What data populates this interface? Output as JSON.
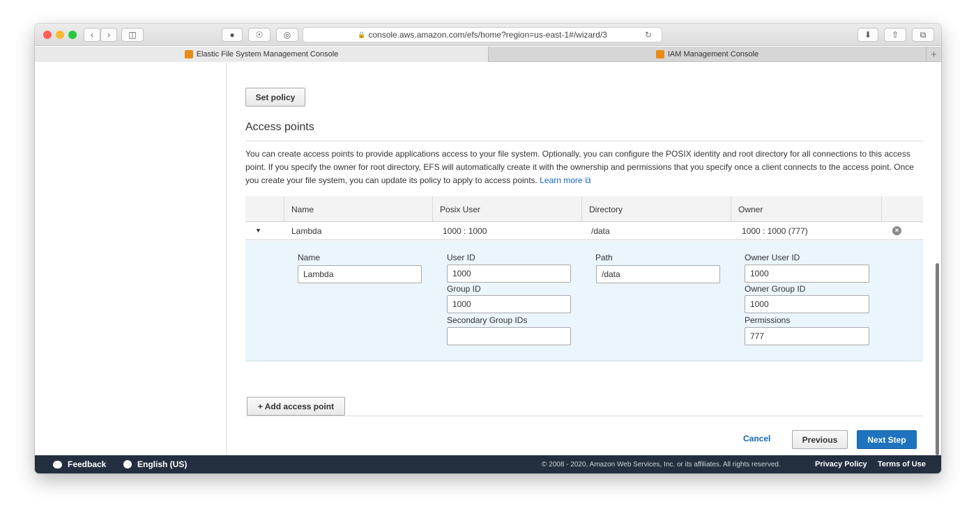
{
  "browser": {
    "url": "console.aws.amazon.com/efs/home?region=us-east-1#/wizard/3",
    "tabs": [
      {
        "label": "Elastic File System Management Console",
        "active": true
      },
      {
        "label": "IAM Management Console",
        "active": false
      }
    ],
    "new_tab_label": "+"
  },
  "set_policy_label": "Set policy",
  "access_points": {
    "heading": "Access points",
    "description": "You can create access points to provide applications access to your file system. Optionally, you can configure the POSIX identity and root directory for all connections to this access point. If you specify the owner for root directory, EFS will automatically create it with the ownership and permissions that you specify once a client connects to the access point. Once you create your file system, you can update its policy to apply to access points.",
    "learn_more": "Learn more",
    "columns": {
      "name": "Name",
      "posix_user": "Posix User",
      "directory": "Directory",
      "owner": "Owner"
    },
    "rows": [
      {
        "name": "Lambda",
        "posix_user": "1000 : 1000",
        "directory": "/data",
        "owner": "1000 : 1000 (777)"
      }
    ],
    "detail": {
      "name_label": "Name",
      "name_value": "Lambda",
      "user_id_label": "User ID",
      "user_id_value": "1000",
      "group_id_label": "Group ID",
      "group_id_value": "1000",
      "secondary_label": "Secondary Group IDs",
      "secondary_value": "",
      "path_label": "Path",
      "path_value": "/data",
      "owner_user_label": "Owner User ID",
      "owner_user_value": "1000",
      "owner_group_label": "Owner Group ID",
      "owner_group_value": "1000",
      "permissions_label": "Permissions",
      "permissions_value": "777"
    },
    "add_label": "+ Add access point"
  },
  "actions": {
    "cancel": "Cancel",
    "previous": "Previous",
    "next": "Next Step"
  },
  "footer": {
    "feedback": "Feedback",
    "language": "English (US)",
    "copyright": "© 2008 - 2020, Amazon Web Services, Inc. or its affiliates. All rights reserved.",
    "privacy": "Privacy Policy",
    "terms": "Terms of Use"
  },
  "colors": {
    "accent": "#1e73be",
    "footer_bg": "#232f3e",
    "panel_bg": "#eaf5fc"
  }
}
